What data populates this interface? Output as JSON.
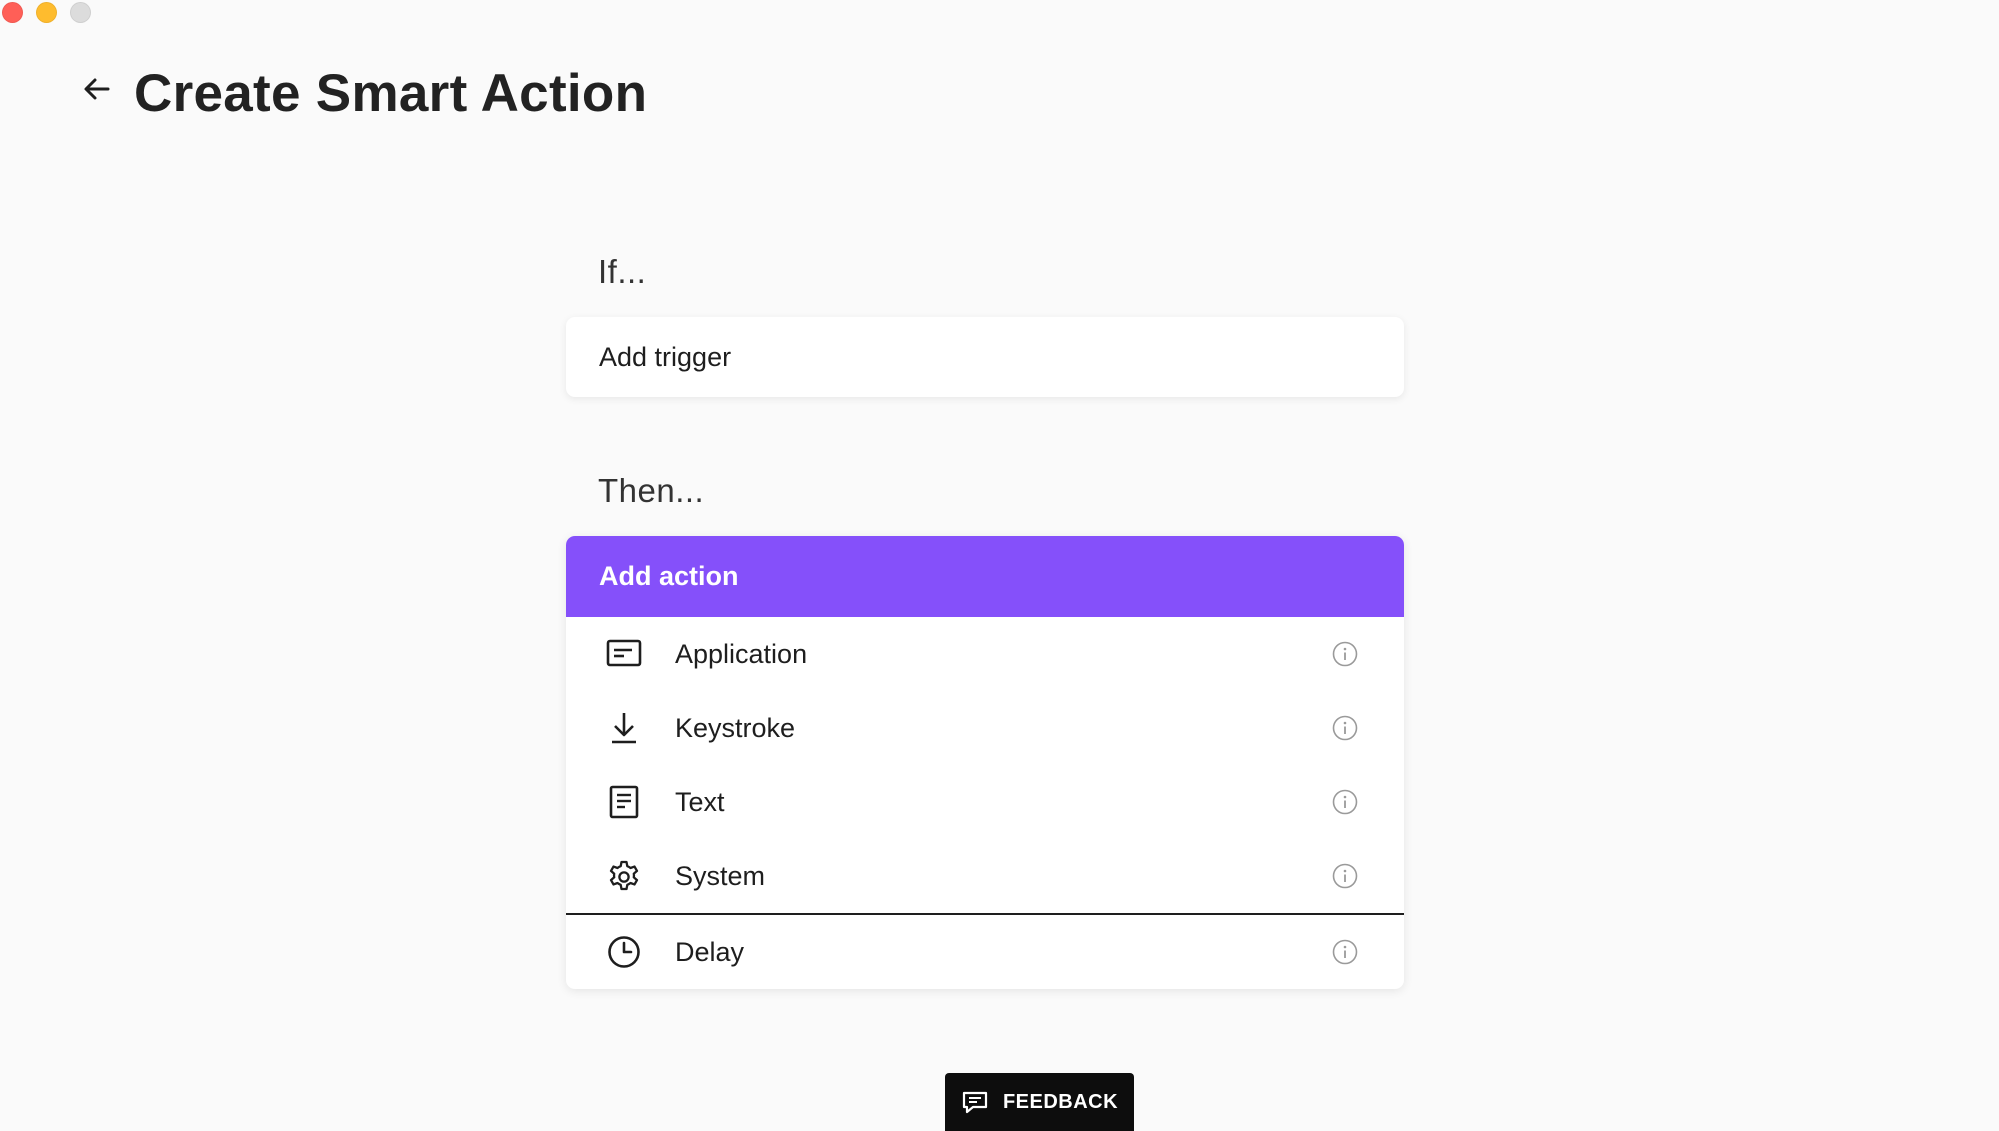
{
  "window": {
    "title": "Create Smart Action"
  },
  "header": {
    "title": "Create Smart Action",
    "back_icon": "arrow-left-icon"
  },
  "if_section": {
    "label": "If...",
    "trigger_label": "Add trigger"
  },
  "then_section": {
    "label": "Then...",
    "header_label": "Add action",
    "accent_color": "#8550fa",
    "items": [
      {
        "label": "Application",
        "icon": "application-window-icon"
      },
      {
        "label": "Keystroke",
        "icon": "keystroke-download-icon"
      },
      {
        "label": "Text",
        "icon": "text-document-icon"
      },
      {
        "label": "System",
        "icon": "gear-icon"
      },
      {
        "label": "Delay",
        "icon": "clock-icon"
      }
    ]
  },
  "feedback": {
    "label": "FEEDBACK",
    "icon": "chat-icon"
  }
}
